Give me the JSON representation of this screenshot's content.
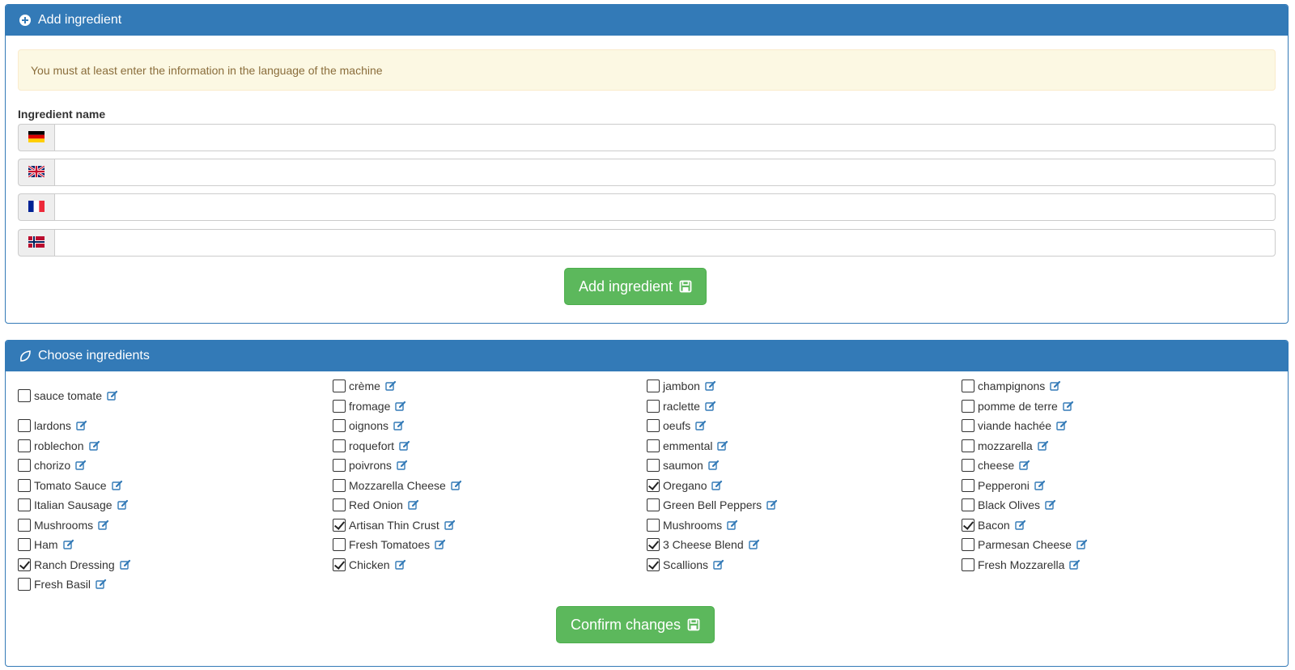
{
  "add_panel": {
    "title": "Add ingredient",
    "alert": "You must at least enter the information in the language of the machine",
    "field_label": "Ingredient name",
    "languages": [
      {
        "flag": "de-flag-icon",
        "value": ""
      },
      {
        "flag": "gb-flag-icon",
        "value": ""
      },
      {
        "flag": "fr-flag-icon",
        "value": ""
      },
      {
        "flag": "no-flag-icon",
        "value": ""
      }
    ],
    "button_label": "Add ingredient"
  },
  "choose_panel": {
    "title": "Choose ingredients",
    "button_label": "Confirm changes",
    "columns": [
      [
        {
          "label": "sauce tomate",
          "checked": false
        },
        {
          "label": "lardons",
          "checked": false
        },
        {
          "label": "roblechon",
          "checked": false
        },
        {
          "label": "chorizo",
          "checked": false
        },
        {
          "label": "Tomato Sauce",
          "checked": false
        },
        {
          "label": "Italian Sausage",
          "checked": false
        },
        {
          "label": "Mushrooms",
          "checked": false
        },
        {
          "label": "Ham",
          "checked": false
        },
        {
          "label": "Ranch Dressing",
          "checked": true
        },
        {
          "label": "Fresh Basil",
          "checked": false
        }
      ],
      [
        {
          "label": "crème",
          "checked": false
        },
        {
          "label": "fromage",
          "checked": false
        },
        {
          "label": "oignons",
          "checked": false
        },
        {
          "label": "roquefort",
          "checked": false
        },
        {
          "label": "poivrons",
          "checked": false
        },
        {
          "label": "Mozzarella Cheese",
          "checked": false
        },
        {
          "label": "Red Onion",
          "checked": false
        },
        {
          "label": "Artisan Thin Crust",
          "checked": true
        },
        {
          "label": "Fresh Tomatoes",
          "checked": false
        },
        {
          "label": "Chicken",
          "checked": true
        }
      ],
      [
        {
          "label": "jambon",
          "checked": false
        },
        {
          "label": "raclette",
          "checked": false
        },
        {
          "label": "oeufs",
          "checked": false
        },
        {
          "label": "emmental",
          "checked": false
        },
        {
          "label": "saumon",
          "checked": false
        },
        {
          "label": "Oregano",
          "checked": true
        },
        {
          "label": "Green Bell Peppers",
          "checked": false
        },
        {
          "label": "Mushrooms",
          "checked": false
        },
        {
          "label": "3 Cheese Blend",
          "checked": true
        },
        {
          "label": "Scallions",
          "checked": true
        }
      ],
      [
        {
          "label": "champignons",
          "checked": false
        },
        {
          "label": "pomme de terre",
          "checked": false
        },
        {
          "label": "viande hachée",
          "checked": false
        },
        {
          "label": "mozzarella",
          "checked": false
        },
        {
          "label": "cheese",
          "checked": false
        },
        {
          "label": "Pepperoni",
          "checked": false
        },
        {
          "label": "Black Olives",
          "checked": false
        },
        {
          "label": "Bacon",
          "checked": true
        },
        {
          "label": "Parmesan Cheese",
          "checked": false
        },
        {
          "label": "Fresh Mozzarella",
          "checked": false
        }
      ]
    ]
  },
  "colors": {
    "primary": "#337ab7",
    "success": "#5cb85c",
    "warning_bg": "#fcf8e3",
    "warning_text": "#8a6d3b",
    "edit_icon": "#337ab7"
  }
}
